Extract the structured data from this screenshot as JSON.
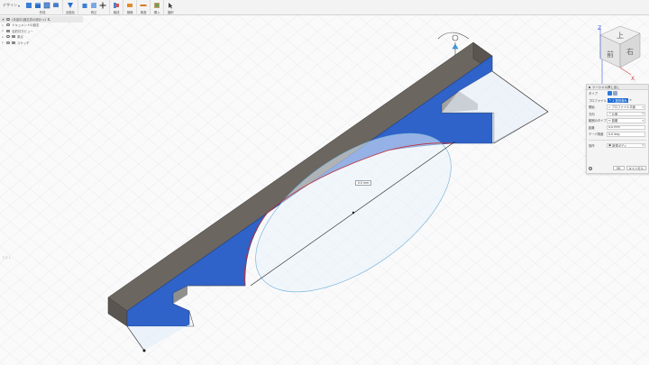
{
  "toolbar": {
    "workspace_label": "デザイン",
    "groups": [
      {
        "label": "作成",
        "icons": [
          "new-component-icon",
          "sketch-icon",
          "box-icon",
          "cylinder-icon"
        ]
      },
      {
        "label": "自動化",
        "icons": [
          "automate-icon"
        ]
      },
      {
        "label": "修正",
        "icons": [
          "press-pull-icon",
          "fillet-icon",
          "move-icon"
        ]
      },
      {
        "label": "構成",
        "icons": [
          "assemble-icon"
        ]
      },
      {
        "label": "構築",
        "icons": [
          "construct-icon"
        ]
      },
      {
        "label": "検査",
        "icons": [
          "inspect-icon"
        ]
      },
      {
        "label": "挿入",
        "icons": [
          "insert-icon"
        ]
      },
      {
        "label": "選択",
        "icons": [
          "select-icon"
        ]
      }
    ]
  },
  "browser": {
    "document": "(未保存)固定具の設計 v1",
    "items": [
      "ドキュメントの設定",
      "名前付きビュー",
      "原点",
      "スケッチ"
    ]
  },
  "viewport": {
    "dimension_value": "0.0 mm",
    "left_tag": "ラスト"
  },
  "viewcube": {
    "top": "上",
    "front": "前",
    "right": "右",
    "axis_x": "X",
    "axis_z": "Z"
  },
  "dialog": {
    "title": "ソーシャル押し出し",
    "rows": [
      {
        "label": "タイプ",
        "kind": "type"
      },
      {
        "label": "プロファイル",
        "kind": "chip",
        "value": "1 選択済み"
      },
      {
        "label": "開始",
        "value": "プロファイル平面"
      },
      {
        "label": "方向",
        "value": "片側"
      },
      {
        "label": "範囲のタイプ",
        "value": "距離"
      },
      {
        "label": "距離",
        "value": "0.0 mm"
      },
      {
        "label": "テーパ角度",
        "value": "0.0 deg"
      },
      {
        "label": "操作",
        "value": "新規ボディ"
      }
    ],
    "ok": "OK",
    "cancel": "キャンセル"
  },
  "colors": {
    "profile_blue": "#2f63c9",
    "body_gray": "#6b6660",
    "grid_line": "#e3e7ec",
    "selection_edge": "#c0303a"
  }
}
